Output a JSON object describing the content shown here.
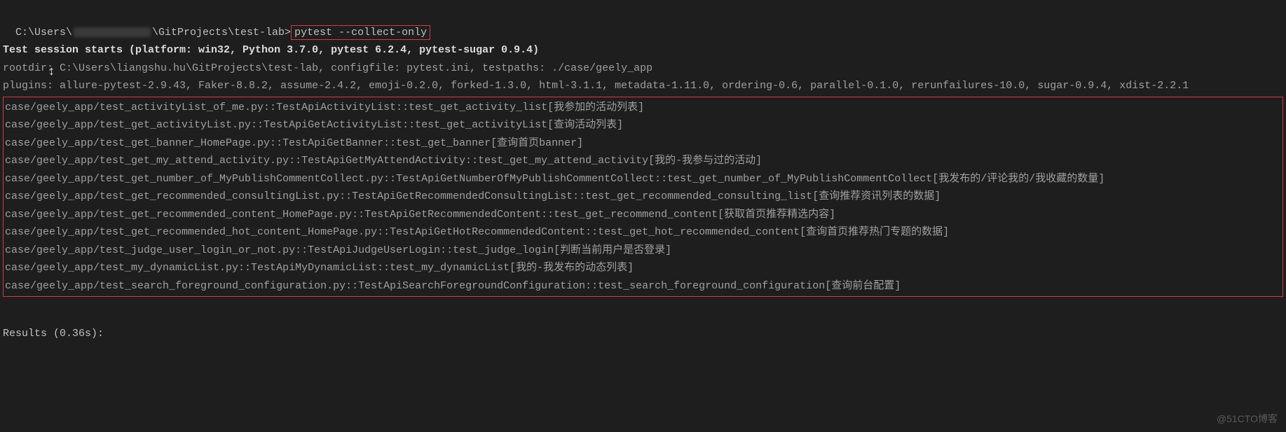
{
  "prompt": {
    "prefix": "C:\\Users\\",
    "suffix": "\\GitProjects\\test-lab>",
    "command": "pytest --collect-only"
  },
  "session_header": "Test session starts (platform: win32, Python 3.7.0, pytest 6.2.4, pytest-sugar 0.9.4)",
  "rootdir_line": "rootdir: C:\\Users\\liangshu.hu\\GitProjects\\test-lab, configfile: pytest.ini, testpaths: ./case/geely_app",
  "plugins_line": "plugins: allure-pytest-2.9.43, Faker-8.8.2, assume-2.4.2, emoji-0.2.0, forked-1.3.0, html-3.1.1, metadata-1.11.0, ordering-0.6, parallel-0.1.0, rerunfailures-10.0, sugar-0.9.4, xdist-2.2.1",
  "collected_tests": [
    "case/geely_app/test_activityList_of_me.py::TestApiActivityList::test_get_activity_list[我参加的活动列表]",
    "case/geely_app/test_get_activityList.py::TestApiGetActivityList::test_get_activityList[查询活动列表]",
    "case/geely_app/test_get_banner_HomePage.py::TestApiGetBanner::test_get_banner[查询首页banner]",
    "case/geely_app/test_get_my_attend_activity.py::TestApiGetMyAttendActivity::test_get_my_attend_activity[我的-我参与过的活动]",
    "case/geely_app/test_get_number_of_MyPublishCommentCollect.py::TestApiGetNumberOfMyPublishCommentCollect::test_get_number_of_MyPublishCommentCollect[我发布的/评论我的/我收藏的数量]",
    "case/geely_app/test_get_recommended_consultingList.py::TestApiGetRecommendedConsultingList::test_get_recommended_consulting_list[查询推荐资讯列表的数据]",
    "case/geely_app/test_get_recommended_content_HomePage.py::TestApiGetRecommendedContent::test_get_recommend_content[获取首页推荐精选内容]",
    "case/geely_app/test_get_recommended_hot_content_HomePage.py::TestApiGetHotRecommendedContent::test_get_hot_recommended_content[查询首页推荐热门专题的数据]",
    "case/geely_app/test_judge_user_login_or_not.py::TestApiJudgeUserLogin::test_judge_login[判断当前用户是否登录]",
    "case/geely_app/test_my_dynamicList.py::TestApiMyDynamicList::test_my_dynamicList[我的-我发布的动态列表]",
    "case/geely_app/test_search_foreground_configuration.py::TestApiSearchForegroundConfiguration::test_search_foreground_configuration[查询前台配置]"
  ],
  "results_line": "Results (0.36s):",
  "watermark": "@51CTO博客",
  "cursor_icon": "↕"
}
